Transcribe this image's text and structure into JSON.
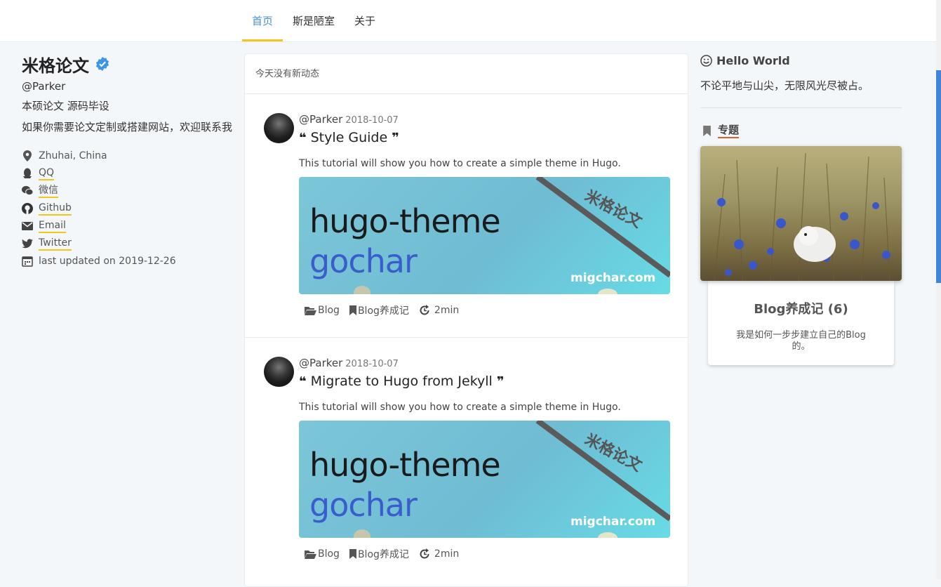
{
  "nav": {
    "items": [
      "首页",
      "斯是陋室",
      "关于"
    ],
    "active": 0
  },
  "profile": {
    "title": "米格论文",
    "handle": "@Parker",
    "desc1": "本硕论文 源码毕设",
    "desc2": "如果你需要论文定制或搭建网站，欢迎联系我",
    "location": "Zhuhai, China",
    "links": [
      {
        "label": "QQ",
        "icon": "qq-icon"
      },
      {
        "label": "微信",
        "icon": "wechat-icon"
      },
      {
        "label": "Github",
        "icon": "github-icon"
      },
      {
        "label": "Email",
        "icon": "email-icon"
      },
      {
        "label": "Twitter",
        "icon": "twitter-icon"
      }
    ],
    "updated": "last updated on 2019-12-26"
  },
  "feed": {
    "notice": "今天没有新动态",
    "posts": [
      {
        "author": "@Parker",
        "date": "2018-10-07",
        "title": "Style Guide",
        "summary": "This tutorial will show you how to create a simple theme in Hugo.",
        "banner": {
          "line1": "hugo-theme",
          "line2": "gochar",
          "url": "migchar.com",
          "stamp": "米格论文"
        },
        "category": "Blog",
        "series": "Blog养成记",
        "read_time": "2min"
      },
      {
        "author": "@Parker",
        "date": "2018-10-07",
        "title": "Migrate to Hugo from Jekyll",
        "summary": "This tutorial will show you how to create a simple theme in Hugo.",
        "banner": {
          "line1": "hugo-theme",
          "line2": "gochar",
          "url": "migchar.com",
          "stamp": "米格论文"
        },
        "category": "Blog",
        "series": "Blog养成记",
        "read_time": "2min"
      }
    ]
  },
  "sidebar": {
    "hello_title": "Hello World",
    "hello_text": "不论平地与山尖，无限风光尽被占。",
    "topics_label": "专题",
    "card": {
      "title": "Blog养成记 (6)",
      "desc": "我是如何一步步建立自己的Blog的。"
    }
  },
  "colors": {
    "accent": "#4a8fd6",
    "underline": "#f5c518",
    "topic_underline": "#d9622b"
  }
}
